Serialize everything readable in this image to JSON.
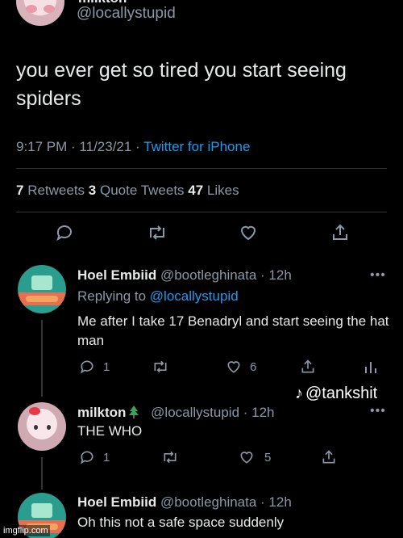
{
  "top_tweet": {
    "author_name": "milkton",
    "handle": "@locallystupid",
    "text": "you ever get so tired you start seeing spiders",
    "time": "9:17 PM · 11/23/21 · ",
    "source": "Twitter for iPhone",
    "retweets_count": "7",
    "retweets_label": " Retweets ",
    "quotes_count": "3",
    "quotes_label": " Quote Tweets ",
    "likes_count": "47",
    "likes_label": " Likes"
  },
  "replies": [
    {
      "name": "Hoel Embiid",
      "handle": " @bootleghinata · 12h",
      "replying_prefix": "Replying to ",
      "replying_handle": "@locallystupid",
      "text": "Me after I take 17 Benadryl and start seeing the hat man",
      "reply_count": "1",
      "like_count": "6",
      "avatar": "bmo-avatar"
    },
    {
      "name": "milkton",
      "handle": " @locallystupid · 12h",
      "text": "THE WHO",
      "reply_count": "1",
      "like_count": "5",
      "avatar": "hello-kitty-avatar"
    },
    {
      "name": "Hoel Embiid",
      "handle": " @bootleghinata · 12h",
      "text": "Oh this not a safe space suddenly",
      "avatar": "bmo-avatar"
    }
  ],
  "more_label": "•••",
  "watermark": {
    "text": "@tankshit"
  },
  "imgflip": {
    "text": "imgflip.com"
  },
  "colors": {
    "background": "#000000",
    "text": "#e7e9ea",
    "muted": "#8b98a5",
    "link": "#1d9bf0"
  }
}
